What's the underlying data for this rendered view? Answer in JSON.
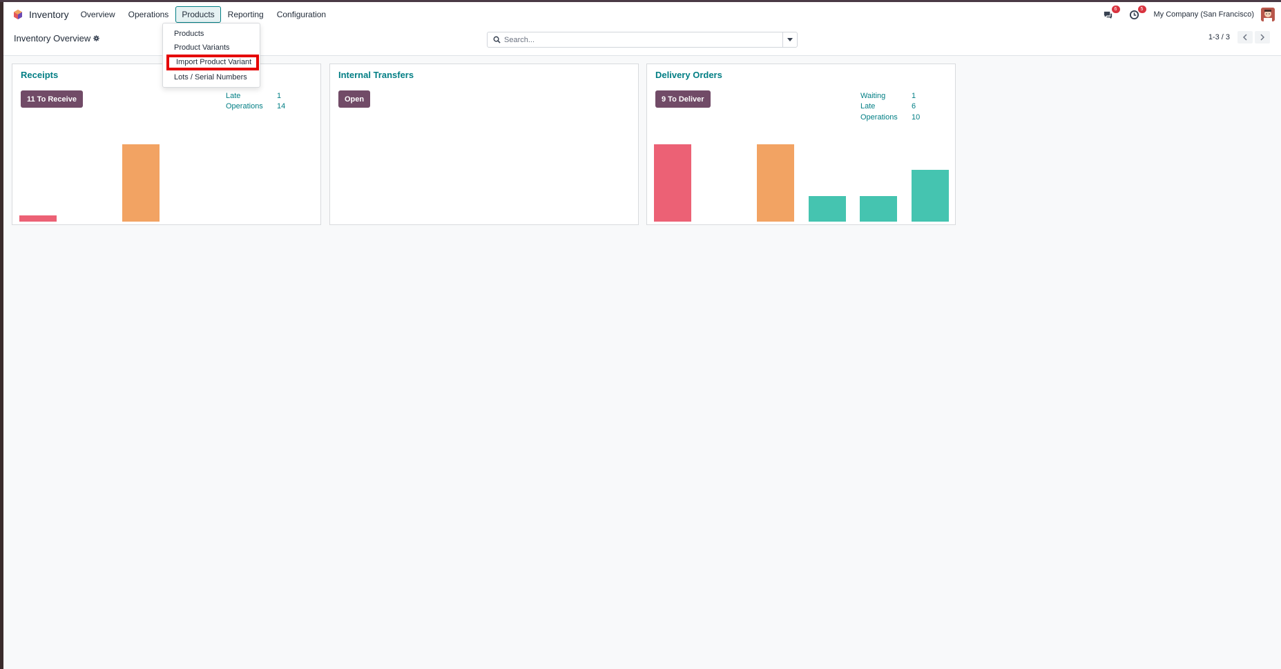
{
  "navbar": {
    "app_name": "Inventory",
    "menu": [
      "Overview",
      "Operations",
      "Products",
      "Reporting",
      "Configuration"
    ],
    "active_menu": "Products",
    "messages_badge": "6",
    "activities_badge": "5",
    "company": "My Company (San Francisco)"
  },
  "products_menu": {
    "items": [
      "Products",
      "Product Variants",
      "Import Product Variant",
      "Lots / Serial Numbers"
    ],
    "highlighted": "Import Product Variant"
  },
  "control_panel": {
    "title": "Inventory Overview",
    "search_placeholder": "Search...",
    "pager": "1-3 / 3"
  },
  "cards": {
    "receipts": {
      "title": "Receipts",
      "button": "11 To Receive",
      "stats": [
        {
          "label": "Late",
          "value": "1"
        },
        {
          "label": "Operations",
          "value": "14"
        }
      ],
      "bars": [
        {
          "level": 0.08,
          "color": "#ec6175"
        },
        {
          "level": 0,
          "color": "#ec6175"
        },
        {
          "level": 1.0,
          "color": "#f2a363"
        },
        {
          "level": 0,
          "color": "#45c4b0"
        },
        {
          "level": 0,
          "color": "#45c4b0"
        },
        {
          "level": 0,
          "color": "#45c4b0"
        }
      ]
    },
    "internal": {
      "title": "Internal Transfers",
      "button": "Open"
    },
    "delivery": {
      "title": "Delivery Orders",
      "button": "9 To Deliver",
      "stats": [
        {
          "label": "Waiting",
          "value": "1"
        },
        {
          "label": "Late",
          "value": "6"
        },
        {
          "label": "Operations",
          "value": "10"
        }
      ],
      "bars": [
        {
          "level": 1.0,
          "color": "#ec6175"
        },
        {
          "level": 0,
          "color": "#ec6175"
        },
        {
          "level": 1.0,
          "color": "#f2a363"
        },
        {
          "level": 0.33,
          "color": "#45c4b0"
        },
        {
          "level": 0.33,
          "color": "#45c4b0"
        },
        {
          "level": 0.67,
          "color": "#45c4b0"
        }
      ]
    }
  }
}
